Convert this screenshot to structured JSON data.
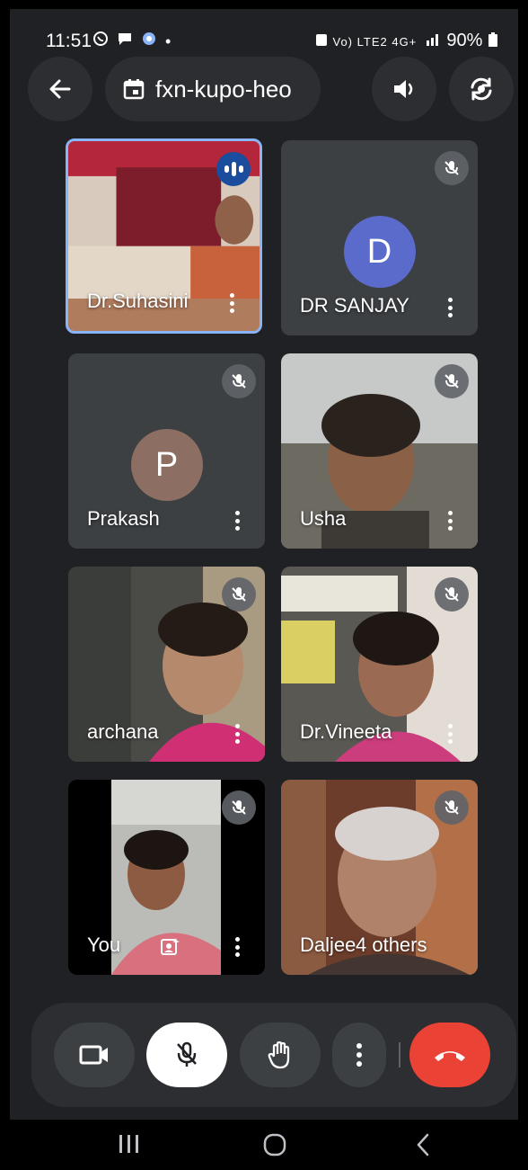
{
  "status_bar": {
    "time": "11:51",
    "notification_icons": [
      "whatsapp-icon",
      "chat-icon",
      "app-icon"
    ],
    "extra_dot": "•",
    "signal_text": "Vo) LTE2 4G+",
    "battery": "90%"
  },
  "top_bar": {
    "meeting_code": "fxn-kupo-heo",
    "back_icon": "arrow-back-icon",
    "calendar_icon": "calendar-icon",
    "speaker_icon": "speaker-icon",
    "switch_camera_icon": "switch-camera-icon"
  },
  "participants": [
    {
      "name": "Dr.Suhasini",
      "video": true,
      "speaking": true,
      "muted": false
    },
    {
      "name": "DR SANJAY",
      "video": false,
      "avatar_letter": "D",
      "avatar_color": "#5b6bcc",
      "muted": true
    },
    {
      "name": "Prakash",
      "video": false,
      "avatar_letter": "P",
      "avatar_color": "#8d6e63",
      "muted": true
    },
    {
      "name": "Usha",
      "video": true,
      "muted": true
    },
    {
      "name": "archana",
      "video": true,
      "muted": true
    },
    {
      "name": "Dr.Vineeta",
      "video": true,
      "muted": true
    },
    {
      "name": "You",
      "video": true,
      "muted": true,
      "self": true
    },
    {
      "name": "Daljeet",
      "video": true,
      "muted": true,
      "overflow_label": "4 others"
    }
  ],
  "controls": {
    "camera_icon": "video-camera-icon",
    "mic_icon": "mic-off-icon",
    "hand_icon": "raise-hand-icon",
    "more_icon": "more-vert-icon",
    "leave_icon": "call-end-icon"
  },
  "colors": {
    "background": "#202124",
    "surface": "#2d2e31",
    "tile": "#3c4043",
    "leave": "#ea4335",
    "active_border": "#8ab4f8"
  }
}
